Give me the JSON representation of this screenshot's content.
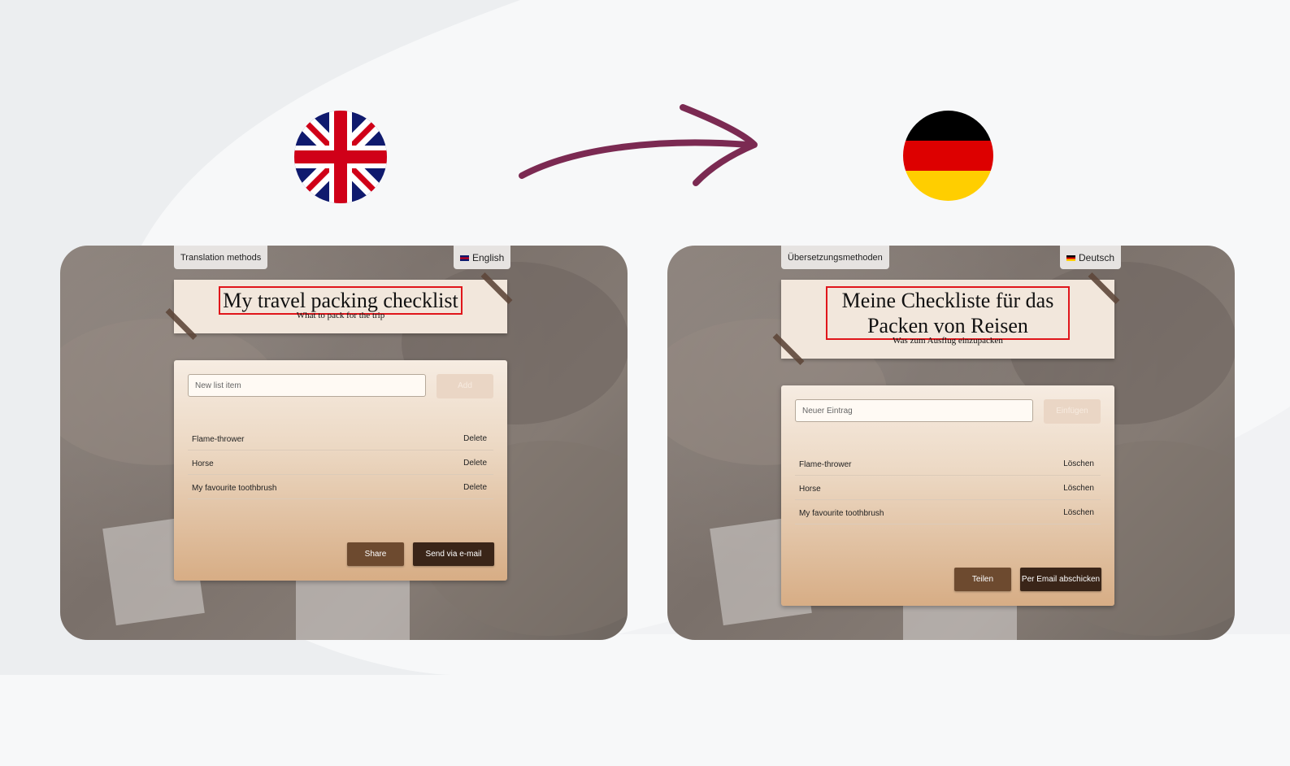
{
  "left": {
    "methods_label": "Translation methods",
    "language_label": "English",
    "title": "My travel packing checklist",
    "subtitle": "What to pack for the trip",
    "input_placeholder": "New list item",
    "add_label": "Add",
    "items": [
      {
        "name": "Flame-thrower",
        "action": "Delete"
      },
      {
        "name": "Horse",
        "action": "Delete"
      },
      {
        "name": "My favourite toothbrush",
        "action": "Delete"
      }
    ],
    "share_label": "Share",
    "email_label": "Send via e-mail"
  },
  "right": {
    "methods_label": "Übersetzungsmethoden",
    "language_label": "Deutsch",
    "title": "Meine Checkliste für das Packen von Reisen",
    "subtitle": "Was zum Ausflug einzupacken",
    "input_placeholder": "Neuer Eintrag",
    "add_label": "Einfügen",
    "items": [
      {
        "name": "Flame-thrower",
        "action": "Löschen"
      },
      {
        "name": "Horse",
        "action": "Löschen"
      },
      {
        "name": "My favourite toothbrush",
        "action": "Löschen"
      }
    ],
    "share_label": "Teilen",
    "email_label": "Per Email abschicken"
  },
  "icons": {
    "source_flag": "uk-flag-icon",
    "target_flag": "germany-flag-icon",
    "arrow": "arrow-right-icon"
  },
  "colors": {
    "arrow": "#7b2a52",
    "highlight": "#e0161b",
    "share_button": "#6d4a2f",
    "email_button": "#3a2518"
  }
}
